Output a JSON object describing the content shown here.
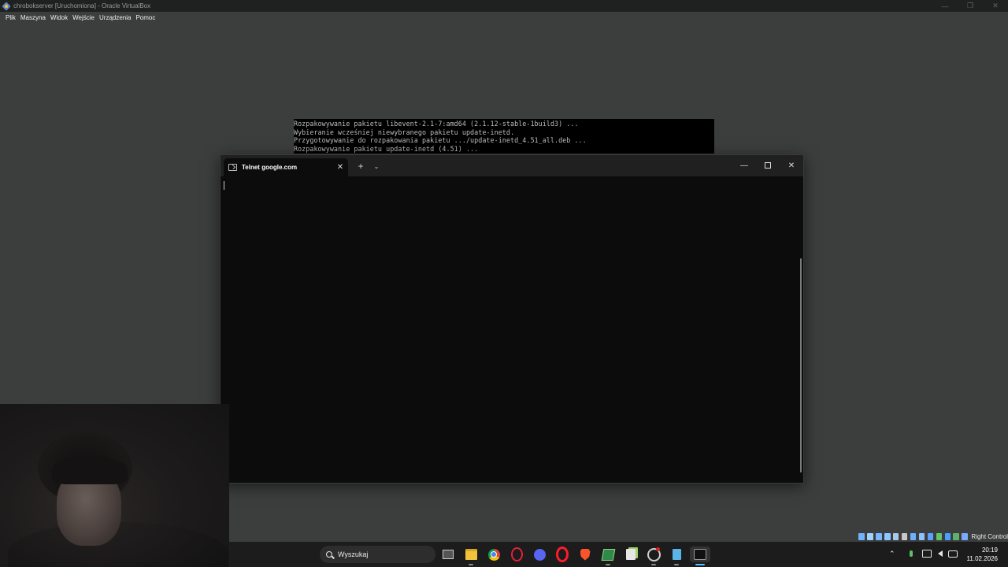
{
  "host_window": {
    "title": "chrobokserver [Uruchomiona] - Oracle VirtualBox",
    "menu": [
      "Plik",
      "Maszyna",
      "Widok",
      "Wejście",
      "Urządzenia",
      "Pomoc"
    ]
  },
  "guest_console": {
    "lines": [
      "Rozpakowywanie pakietu libevent-2.1-7:amd64 (2.1.12-stable-1build3) ...",
      "Wybieranie wcześniej niewybranego pakietu update-inetd.",
      "Przygotowywanie do rozpakowania pakietu .../update-inetd_4.51_all.deb ...",
      "Rozpakowywanie pakietu update-inetd (4.51) ..."
    ]
  },
  "terminal": {
    "tab_title": "Telnet google.com",
    "tab_icon": "console-icon",
    "new_tab_symbol": "+",
    "dropdown_symbol": "⌄",
    "close_symbol": "✕",
    "minimize_symbol": "—"
  },
  "vbox_status": {
    "host_key_label": "Right Control",
    "icon_colors": [
      "#6fb3ff",
      "#9fd0ff",
      "#7ab6ff",
      "#8ec6ff",
      "#a6cbe8",
      "#c9c9c9",
      "#6cb0ff",
      "#8ec2ff",
      "#5ca0ff",
      "#62c46a",
      "#4aa0ff",
      "#5fb06a",
      "#7aa9ff"
    ]
  },
  "taskbar": {
    "search_placeholder": "Wyszukaj",
    "apps": [
      "start-icon",
      "task-view-icon",
      "file-explorer-icon",
      "chrome-icon",
      "opera-gx-icon",
      "discord-icon",
      "opera-icon",
      "brave-icon",
      "virtualbox-icon",
      "notepad-plus-plus-icon",
      "tray-tool-icon",
      "notepad-icon",
      "terminal-icon"
    ],
    "active_app": "terminal-icon",
    "tray_chevron": "⌃",
    "clock_time": "20:19",
    "clock_date": "11.02.2026"
  },
  "colors": {
    "vm_background": "#3b3e3d",
    "terminal_background": "#0c0c0c",
    "taskbar_background": "#1c1c1c",
    "accent": "#5cc0ff"
  }
}
